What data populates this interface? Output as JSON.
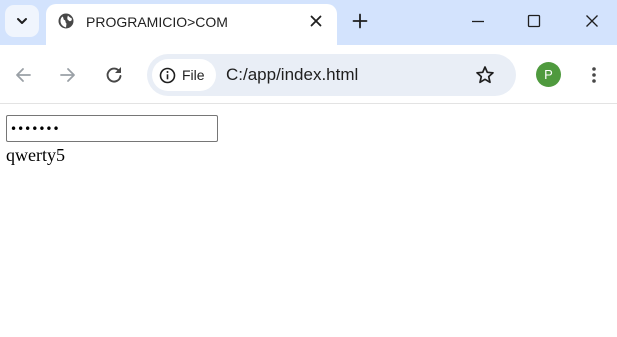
{
  "browser": {
    "tab": {
      "title": "PROGRAMICIO>COM",
      "favicon": "globe-icon"
    },
    "toolbar": {
      "chip_label": "File",
      "url": "C:/app/index.html",
      "profile_initial": "P"
    },
    "icons": {
      "tab_search": "chevron-down-icon",
      "tab_close": "close-icon",
      "new_tab": "plus-icon",
      "minimize": "minimize-icon",
      "maximize": "maximize-icon",
      "window_close": "close-icon",
      "back": "arrow-left-icon",
      "forward": "arrow-right-icon",
      "reload": "reload-icon",
      "site_info": "info-icon",
      "bookmark": "star-icon",
      "menu": "kebab-menu-icon"
    },
    "colors": {
      "tabstrip": "#d3e3fd",
      "omnibox": "#e9eef6",
      "avatar": "#4f9a3e"
    }
  },
  "page": {
    "password_value": "qwerty5",
    "output_text": "qwerty5"
  }
}
